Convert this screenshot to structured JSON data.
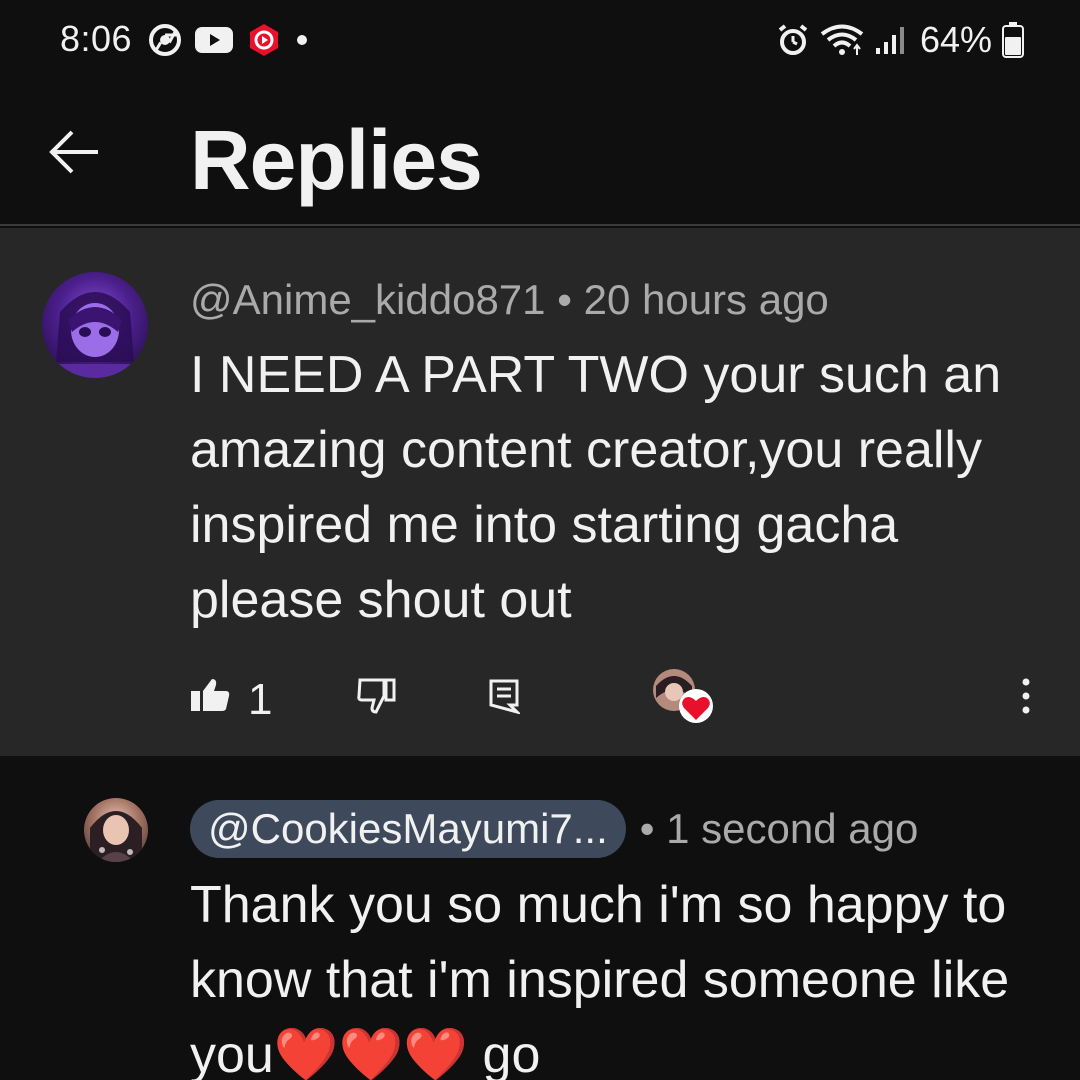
{
  "status_bar": {
    "time": "8:06",
    "battery_percent": "64%",
    "left_icons": [
      "chrome-icon",
      "youtube-icon",
      "youtube-create-icon",
      "notification-dot-icon"
    ],
    "right_icons": [
      "alarm-icon",
      "wifi-icon",
      "signal-icon",
      "battery-icon"
    ]
  },
  "header": {
    "title": "Replies",
    "back_icon": "back-arrow-icon"
  },
  "parent_comment": {
    "author": "@Anime_kiddo871",
    "separator": "•",
    "time": "20 hours ago",
    "text": "I NEED A PART TWO your such an amazing content creator,you really inspired me into starting gacha please shout out",
    "like_count": "1",
    "icons": [
      "like-icon",
      "dislike-icon",
      "reply-icon",
      "creator-heart-icon",
      "more-options-icon"
    ]
  },
  "reply": {
    "mention": "@CookiesMayumi7...",
    "separator": "•",
    "time": "1 second ago",
    "text": "Thank you so much i'm so happy to know that i'm inspired someone like you❤️❤️❤️ go"
  },
  "colors": {
    "background": "#0f0f0f",
    "highlight_background": "#272727",
    "text_primary": "#f1f1f1",
    "text_secondary": "#aaaaaa",
    "mention_chip": "#3e4a5c",
    "heart_red": "#e8102a"
  }
}
